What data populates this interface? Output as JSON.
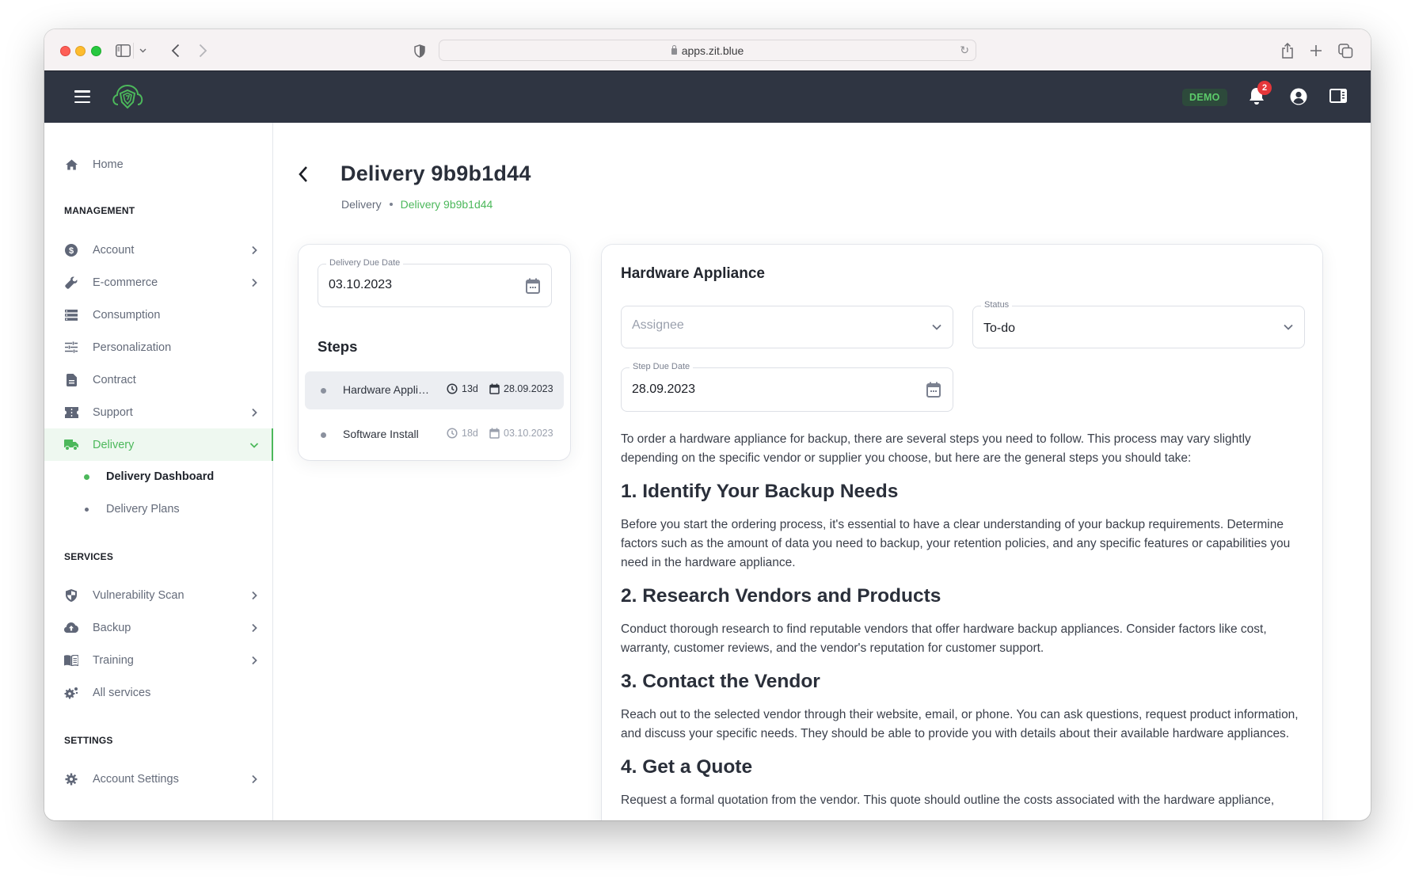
{
  "browser": {
    "url": "apps.zit.blue",
    "icons": [
      "sidebar-toggle-icon",
      "chevron-down-icon",
      "back-arrow-icon",
      "forward-arrow-icon",
      "shield-icon",
      "lock-icon",
      "reload-icon",
      "share-icon",
      "new-tab-icon",
      "tab-overview-icon"
    ]
  },
  "appbar": {
    "demo_badge": "DEMO",
    "notification_count": "2",
    "colors": {
      "background": "#2f3542",
      "accent": "#4cb85b",
      "badge": "#e5363a"
    }
  },
  "sidebar": {
    "home": {
      "label": "Home",
      "icon": "home-icon"
    },
    "sections": [
      {
        "title": "MANAGEMENT",
        "items": [
          {
            "label": "Account",
            "icon": "dollar-circle-icon",
            "has_children": true
          },
          {
            "label": "E-commerce",
            "icon": "wrench-icon",
            "has_children": true
          },
          {
            "label": "Consumption",
            "icon": "list-icon",
            "has_children": false
          },
          {
            "label": "Personalization",
            "icon": "sliders-icon",
            "has_children": false
          },
          {
            "label": "Contract",
            "icon": "document-icon",
            "has_children": false
          },
          {
            "label": "Support",
            "icon": "ticket-icon",
            "has_children": true
          },
          {
            "label": "Delivery",
            "icon": "truck-icon",
            "has_children": true,
            "expanded": true,
            "active": true,
            "children": [
              {
                "label": "Delivery Dashboard",
                "current": true
              },
              {
                "label": "Delivery Plans",
                "current": false
              }
            ]
          }
        ]
      },
      {
        "title": "SERVICES",
        "items": [
          {
            "label": "Vulnerability Scan",
            "icon": "shield-half-icon",
            "has_children": true
          },
          {
            "label": "Backup",
            "icon": "cloud-upload-icon",
            "has_children": true
          },
          {
            "label": "Training",
            "icon": "book-icon",
            "has_children": true
          },
          {
            "label": "All services",
            "icon": "gears-icon",
            "has_children": false
          }
        ]
      },
      {
        "title": "SETTINGS",
        "items": [
          {
            "label": "Account Settings",
            "icon": "gear-icon",
            "has_children": true
          }
        ]
      }
    ]
  },
  "page": {
    "title": "Delivery 9b9b1d44",
    "breadcrumb": [
      {
        "label": "Delivery"
      },
      {
        "label": "Delivery 9b9b1d44",
        "current": true
      }
    ]
  },
  "delivery": {
    "due_date_label": "Delivery Due Date",
    "due_date": "03.10.2023",
    "steps_title": "Steps",
    "steps": [
      {
        "name": "Hardware Appliance",
        "duration": "13d",
        "due": "28.09.2023",
        "selected": true
      },
      {
        "name": "Software Install",
        "duration": "18d",
        "due": "03.10.2023",
        "selected": false
      }
    ]
  },
  "step_detail": {
    "title": "Hardware Appliance",
    "assignee_placeholder": "Assignee",
    "status_label": "Status",
    "status_value": "To-do",
    "due_label": "Step Due Date",
    "due_value": "28.09.2023",
    "content": {
      "intro": "To order a hardware appliance for backup, there are several steps you need to follow. This process may vary slightly depending on the specific vendor or supplier you choose, but here are the general steps you should take:",
      "sections": [
        {
          "heading": "1. Identify Your Backup Needs",
          "body": "Before you start the ordering process, it's essential to have a clear understanding of your backup requirements. Determine factors such as the amount of data you need to backup, your retention policies, and any specific features or capabilities you need in the hardware appliance."
        },
        {
          "heading": "2. Research Vendors and Products",
          "body": "Conduct thorough research to find reputable vendors that offer hardware backup appliances. Consider factors like cost, warranty, customer reviews, and the vendor's reputation for customer support."
        },
        {
          "heading": "3. Contact the Vendor",
          "body": "Reach out to the selected vendor through their website, email, or phone. You can ask questions, request product information, and discuss your specific needs. They should be able to provide you with details about their available hardware appliances."
        },
        {
          "heading": "4. Get a Quote",
          "body": "Request a formal quotation from the vendor. This quote should outline the costs associated with the hardware appliance,"
        }
      ]
    }
  }
}
